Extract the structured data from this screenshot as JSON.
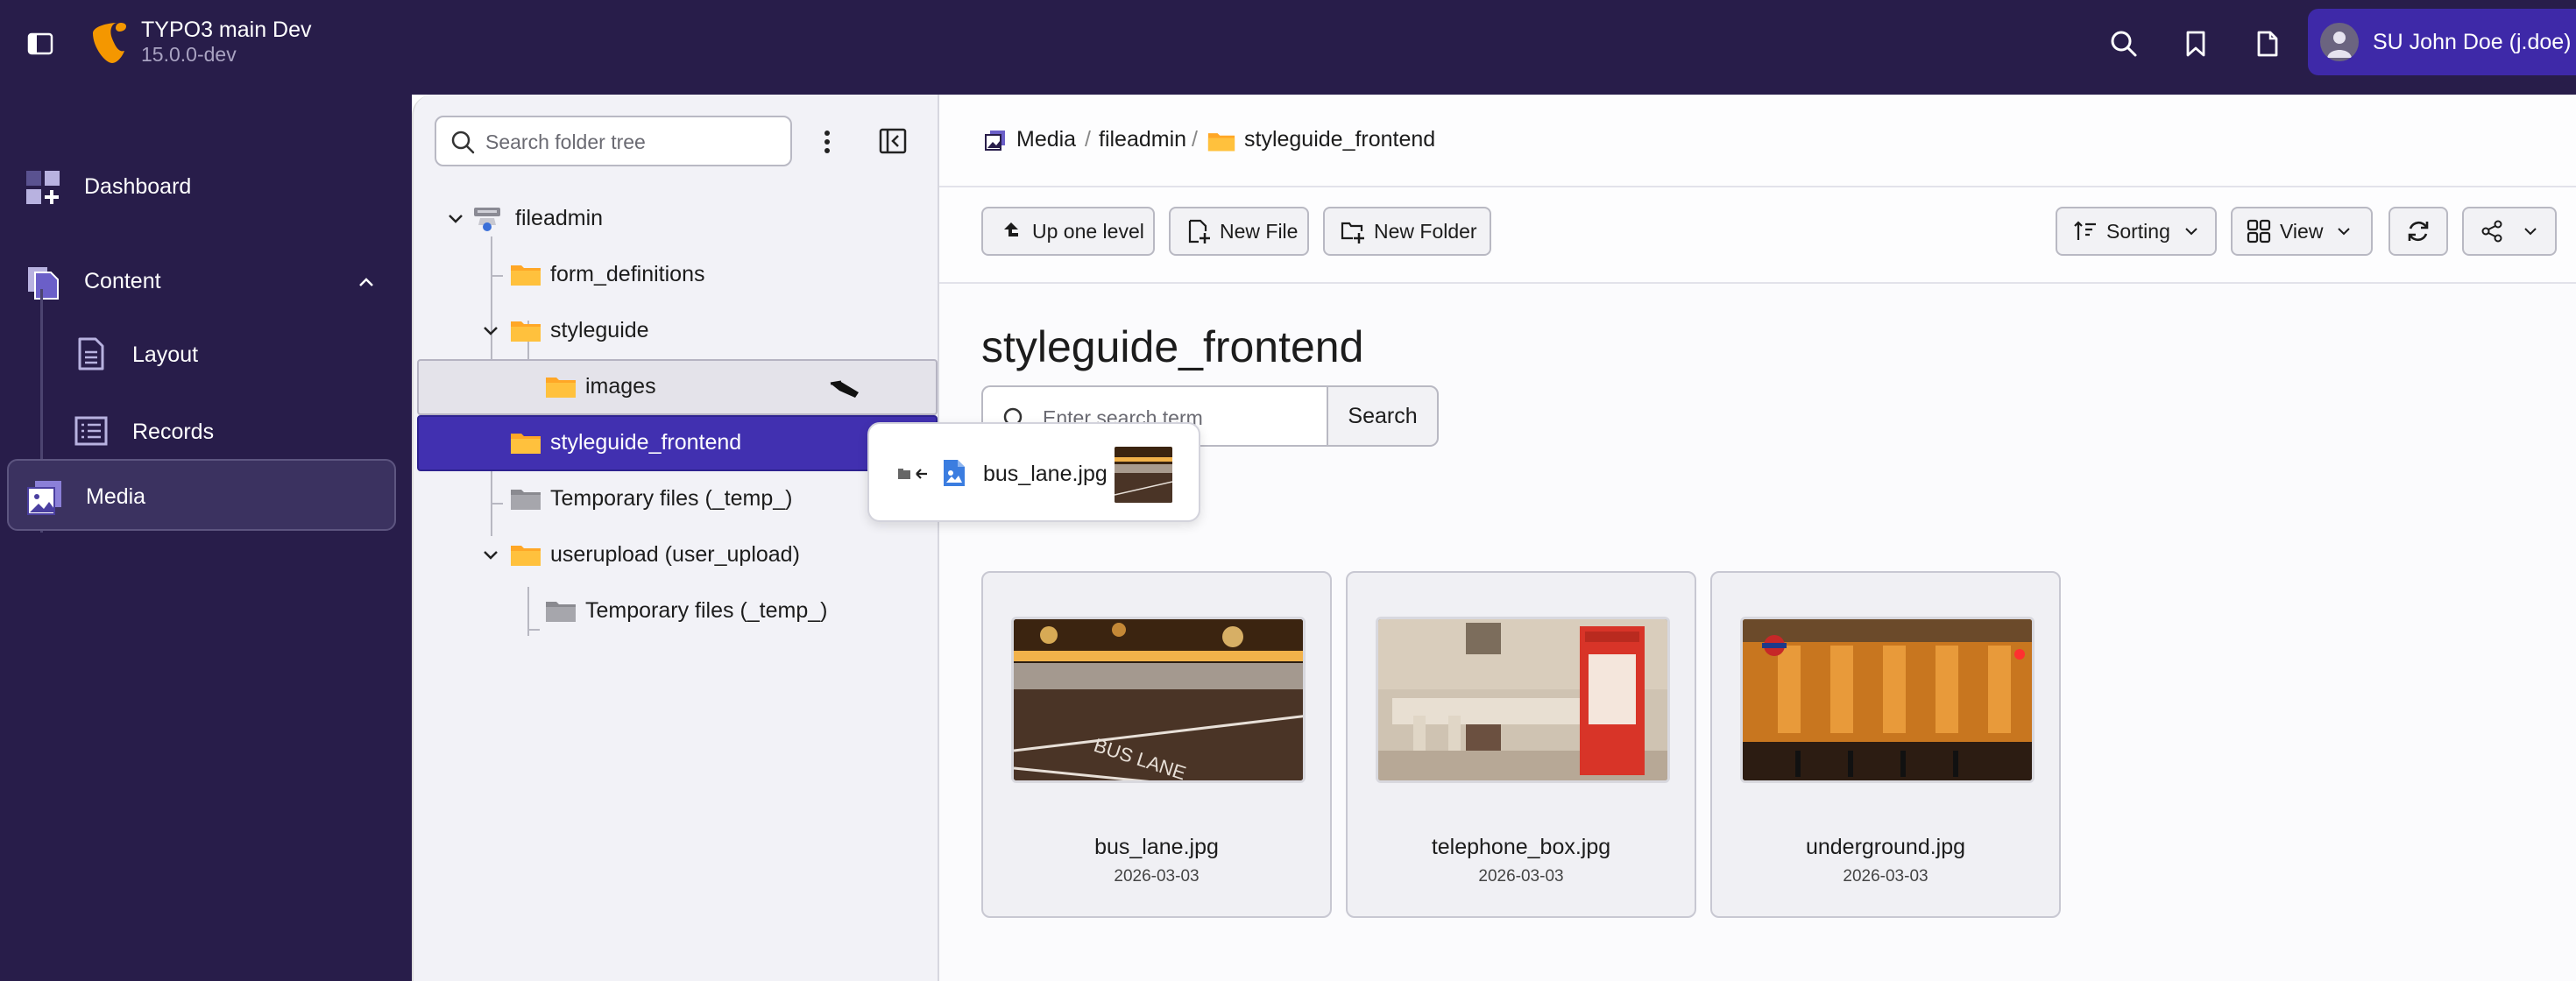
{
  "app": {
    "name": "TYPO3 main Dev",
    "version": "15.0.0-dev",
    "user": "SU John Doe (j.doe)",
    "brand_color": "#281d4a",
    "accent_color": "#4130b0",
    "logo_color": "#f49700"
  },
  "topbar_icons": [
    "sidebar-toggle-icon",
    "search-icon",
    "bookmark-icon",
    "document-icon"
  ],
  "modules": {
    "dashboard": "Dashboard",
    "content": "Content",
    "layout": "Layout",
    "records": "Records",
    "media": "Media"
  },
  "tree": {
    "search_placeholder": "Search folder tree",
    "nodes": [
      {
        "label": "fileadmin",
        "level": 0,
        "expanded": true
      },
      {
        "label": "form_definitions",
        "level": 1
      },
      {
        "label": "styleguide",
        "level": 1,
        "expanded": true
      },
      {
        "label": "images",
        "level": 2,
        "state": "drop-target"
      },
      {
        "label": "styleguide_frontend",
        "level": 1,
        "state": "selected"
      },
      {
        "label": "Temporary files (_temp_)",
        "level": 1
      },
      {
        "label": "userupload (user_upload)",
        "level": 1,
        "expanded": true
      },
      {
        "label": "Temporary files (_temp_)",
        "level": 2
      }
    ]
  },
  "drag_tooltip": {
    "file": "bus_lane.jpg"
  },
  "breadcrumb": [
    "Media",
    "fileadmin",
    "styleguide_frontend"
  ],
  "toolbar": {
    "up_one_level": "Up one level",
    "new_file": "New File",
    "new_folder": "New Folder",
    "sorting": "Sorting",
    "view": "View"
  },
  "page_title": "styleguide_frontend",
  "search": {
    "placeholder": "Enter search term",
    "button": "Search"
  },
  "files": [
    {
      "name": "bus_lane.jpg",
      "date": "2026-03-03"
    },
    {
      "name": "telephone_box.jpg",
      "date": "2026-03-03"
    },
    {
      "name": "underground.jpg",
      "date": "2026-03-03"
    }
  ]
}
